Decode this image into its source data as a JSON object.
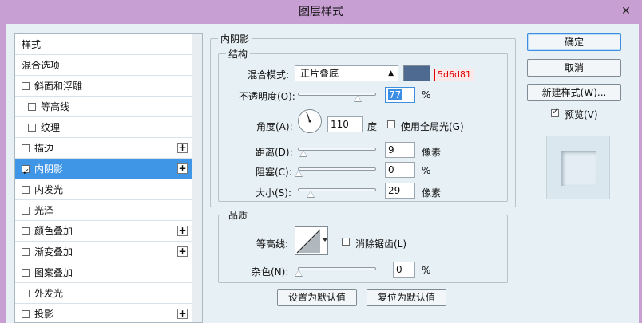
{
  "window": {
    "title": "图层样式",
    "close": "✕"
  },
  "styles_list": {
    "items": [
      {
        "label": "样式",
        "checkbox": false,
        "plus": false,
        "sub": false,
        "selected": false
      },
      {
        "label": "混合选项",
        "checkbox": false,
        "plus": false,
        "sub": false,
        "selected": false
      },
      {
        "label": "斜面和浮雕",
        "checkbox": true,
        "checked": false,
        "plus": false,
        "sub": false,
        "selected": false
      },
      {
        "label": "等高线",
        "checkbox": true,
        "checked": false,
        "plus": false,
        "sub": true,
        "selected": false
      },
      {
        "label": "纹理",
        "checkbox": true,
        "checked": false,
        "plus": false,
        "sub": true,
        "selected": false
      },
      {
        "label": "描边",
        "checkbox": true,
        "checked": false,
        "plus": true,
        "sub": false,
        "selected": false
      },
      {
        "label": "内阴影",
        "checkbox": true,
        "checked": true,
        "plus": true,
        "sub": false,
        "selected": true
      },
      {
        "label": "内发光",
        "checkbox": true,
        "checked": false,
        "plus": false,
        "sub": false,
        "selected": false
      },
      {
        "label": "光泽",
        "checkbox": true,
        "checked": false,
        "plus": false,
        "sub": false,
        "selected": false
      },
      {
        "label": "颜色叠加",
        "checkbox": true,
        "checked": false,
        "plus": true,
        "sub": false,
        "selected": false
      },
      {
        "label": "渐变叠加",
        "checkbox": true,
        "checked": false,
        "plus": true,
        "sub": false,
        "selected": false
      },
      {
        "label": "图案叠加",
        "checkbox": true,
        "checked": false,
        "plus": false,
        "sub": false,
        "selected": false
      },
      {
        "label": "外发光",
        "checkbox": true,
        "checked": false,
        "plus": false,
        "sub": false,
        "selected": false
      },
      {
        "label": "投影",
        "checkbox": true,
        "checked": false,
        "plus": true,
        "sub": false,
        "selected": false
      }
    ],
    "plus_symbol": "+"
  },
  "inner_shadow": {
    "section_title": "内阴影",
    "structure_title": "结构",
    "blend_mode_label": "混合模式:",
    "blend_mode_value": "正片叠底",
    "color_hex": "5d6d81",
    "swatch_color": "#4f6a90",
    "opacity_label": "不透明度(O):",
    "opacity_value": "77",
    "opacity_unit": "%",
    "angle_label": "角度(A):",
    "angle_value": "110",
    "angle_unit": "度",
    "global_light_label": "使用全局光(G)",
    "global_light_checked": false,
    "distance_label": "距离(D):",
    "distance_value": "9",
    "distance_unit": "像素",
    "choke_label": "阻塞(C):",
    "choke_value": "0",
    "choke_unit": "%",
    "size_label": "大小(S):",
    "size_value": "29",
    "size_unit": "像素"
  },
  "quality": {
    "title": "品质",
    "contour_label": "等高线:",
    "antialias_label": "消除锯齿(L)",
    "antialias_checked": false,
    "noise_label": "杂色(N):",
    "noise_value": "0",
    "noise_unit": "%"
  },
  "defaults": {
    "set_default": "设置为默认值",
    "reset_default": "复位为默认值"
  },
  "actions": {
    "ok": "确定",
    "cancel": "取消",
    "new_style": "新建样式(W)...",
    "preview_label": "预览(V)",
    "preview_checked": true
  },
  "colors": {
    "title_bar": "#c89fd3",
    "client_bg": "#e7f0f4",
    "selection": "#3f95e6",
    "hex_tag_red": "#e00000"
  }
}
